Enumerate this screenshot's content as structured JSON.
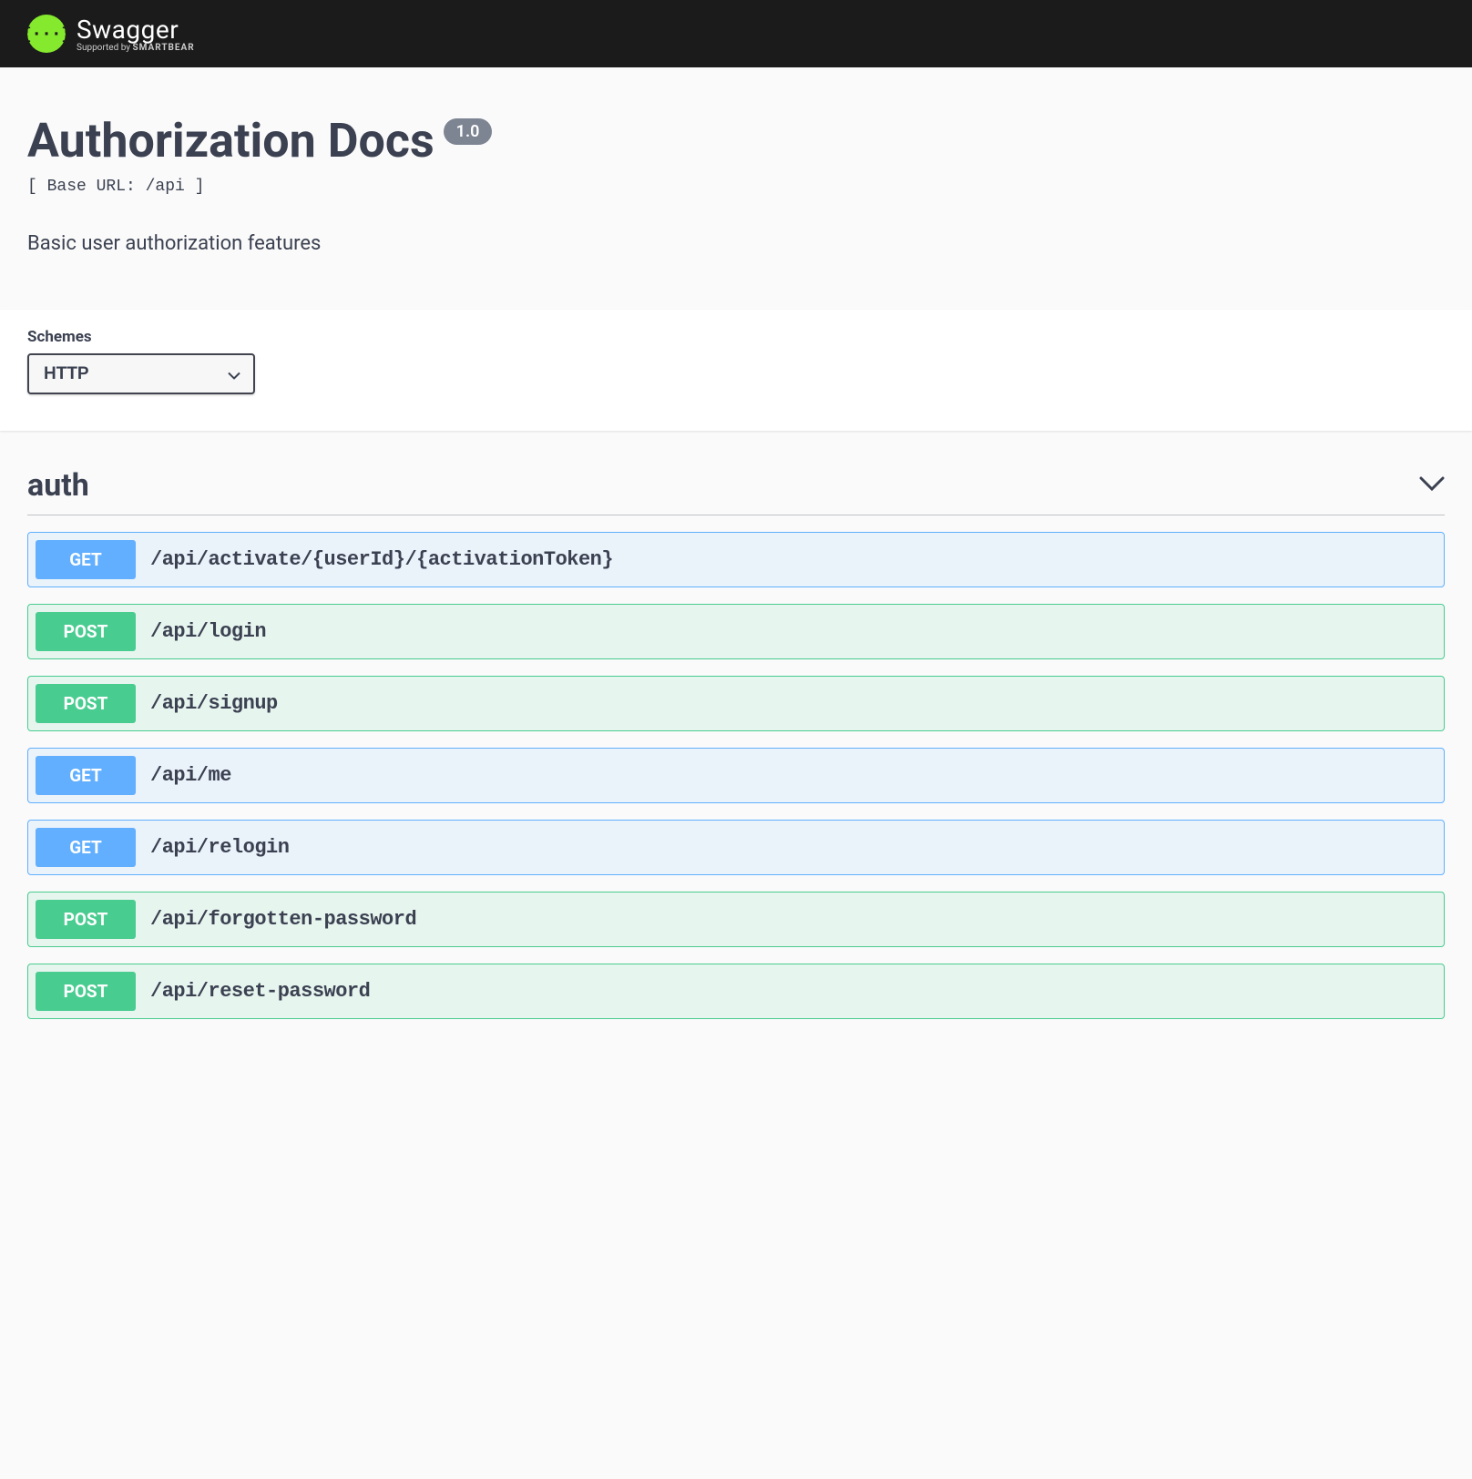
{
  "header": {
    "logo_glyph": "{···}",
    "brand": "Swagger",
    "supported_prefix": "Supported by ",
    "supported_brand": "SMARTBEAR"
  },
  "info": {
    "title": "Authorization Docs",
    "version": "1.0",
    "base_url": "[ Base URL: /api ]",
    "description": "Basic user authorization features"
  },
  "schemes": {
    "label": "Schemes",
    "selected": "HTTP"
  },
  "tag": {
    "name": "auth"
  },
  "operations": [
    {
      "method": "GET",
      "path": "/api/activate/{userId}/{activationToken}"
    },
    {
      "method": "POST",
      "path": "/api/login"
    },
    {
      "method": "POST",
      "path": "/api/signup"
    },
    {
      "method": "GET",
      "path": "/api/me"
    },
    {
      "method": "GET",
      "path": "/api/relogin"
    },
    {
      "method": "POST",
      "path": "/api/forgotten-password"
    },
    {
      "method": "POST",
      "path": "/api/reset-password"
    }
  ]
}
